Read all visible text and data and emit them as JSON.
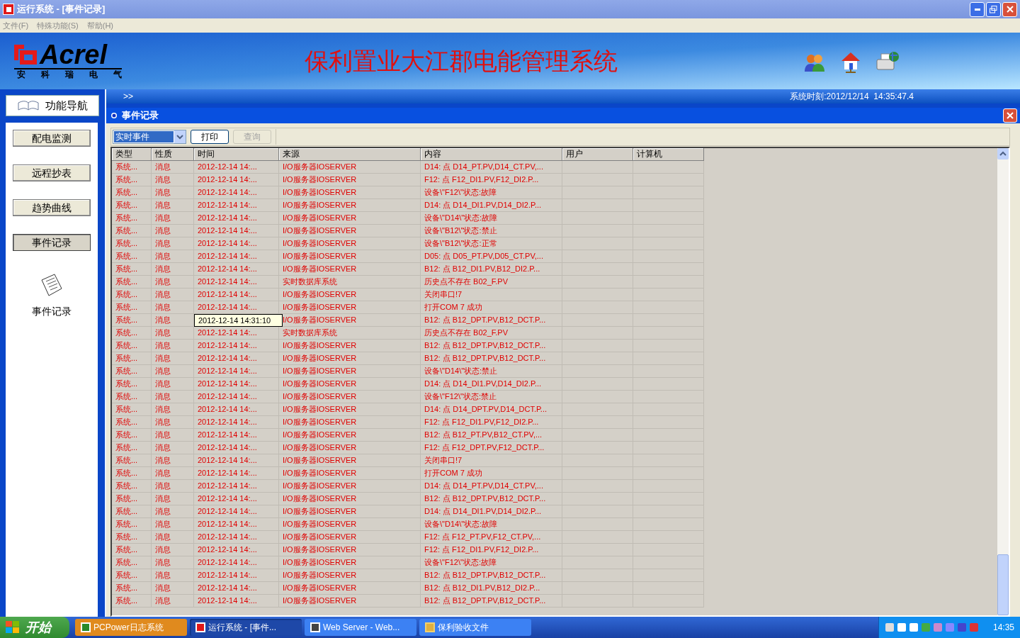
{
  "window": {
    "title": "运行系统 - [事件记录]"
  },
  "menu": [
    "文件(F)",
    "特殊功能(S)",
    "帮助(H)"
  ],
  "banner": {
    "logo": "Acrel",
    "logo_sub": [
      "安",
      "科",
      "瑞",
      "电",
      "气"
    ],
    "title": "保利置业大江郡电能管理系统"
  },
  "subbar": {
    "expander": ">>",
    "system_time": "系统时刻:2012/12/14  14:35:47.4"
  },
  "sidebar": {
    "header": "功能导航",
    "items": [
      {
        "label": "配电监测",
        "selected": false
      },
      {
        "label": "远程抄表",
        "selected": false
      },
      {
        "label": "趋势曲线",
        "selected": false
      },
      {
        "label": "事件记录",
        "selected": true
      }
    ],
    "current": "事件记录"
  },
  "panel": {
    "title": "事件记录",
    "filter": "实时事件",
    "buttons": [
      {
        "label": "打印",
        "disabled": false
      },
      {
        "label": "查询",
        "disabled": true
      }
    ]
  },
  "table": {
    "columns": [
      "类型",
      "性质",
      "时间",
      "来源",
      "内容",
      "用户",
      "计算机"
    ],
    "rows": [
      {
        "type": "系统...",
        "nature": "消息",
        "time": "2012-12-14 14:...",
        "source": "I/O服务器IOSERVER",
        "content": "D14: 点 D14_PT.PV,D14_CT.PV,..."
      },
      {
        "type": "系统...",
        "nature": "消息",
        "time": "2012-12-14 14:...",
        "source": "I/O服务器IOSERVER",
        "content": "F12: 点 F12_DI1.PV,F12_DI2.P..."
      },
      {
        "type": "系统...",
        "nature": "消息",
        "time": "2012-12-14 14:...",
        "source": "I/O服务器IOSERVER",
        "content": "设备\\\"F12\\\"状态:故障"
      },
      {
        "type": "系统...",
        "nature": "消息",
        "time": "2012-12-14 14:...",
        "source": "I/O服务器IOSERVER",
        "content": "D14: 点 D14_DI1.PV,D14_DI2.P..."
      },
      {
        "type": "系统...",
        "nature": "消息",
        "time": "2012-12-14 14:...",
        "source": "I/O服务器IOSERVER",
        "content": "设备\\\"D14\\\"状态:故障"
      },
      {
        "type": "系统...",
        "nature": "消息",
        "time": "2012-12-14 14:...",
        "source": "I/O服务器IOSERVER",
        "content": "设备\\\"B12\\\"状态:禁止"
      },
      {
        "type": "系统...",
        "nature": "消息",
        "time": "2012-12-14 14:...",
        "source": "I/O服务器IOSERVER",
        "content": "设备\\\"B12\\\"状态:正常"
      },
      {
        "type": "系统...",
        "nature": "消息",
        "time": "2012-12-14 14:...",
        "source": "I/O服务器IOSERVER",
        "content": "D05: 点 D05_PT.PV,D05_CT.PV,..."
      },
      {
        "type": "系统...",
        "nature": "消息",
        "time": "2012-12-14 14:...",
        "source": "I/O服务器IOSERVER",
        "content": "B12: 点 B12_DI1.PV,B12_DI2.P..."
      },
      {
        "type": "系统...",
        "nature": "消息",
        "time": "2012-12-14 14:...",
        "source": "实时数据库系统",
        "content": "历史点不存在 B02_F.PV"
      },
      {
        "type": "系统...",
        "nature": "消息",
        "time": "2012-12-14 14:...",
        "source": "I/O服务器IOSERVER",
        "content": "关闭串口!7"
      },
      {
        "type": "系统...",
        "nature": "消息",
        "time": "2012-12-14 14:...",
        "source": "I/O服务器IOSERVER",
        "content": "打开COM 7 成功"
      },
      {
        "type": "系统...",
        "nature": "消息",
        "time_tooltip": "2012-12-14 14:31:10",
        "source": "I/O服务器IOSERVER",
        "content": "B12: 点 B12_DPT.PV,B12_DCT.P..."
      },
      {
        "type": "系统...",
        "nature": "消息",
        "time": "2012-12-14 14:...",
        "source": "实时数据库系统",
        "content": "历史点不存在 B02_F.PV"
      },
      {
        "type": "系统...",
        "nature": "消息",
        "time": "2012-12-14 14:...",
        "source": "I/O服务器IOSERVER",
        "content": "B12: 点 B12_DPT.PV,B12_DCT.P..."
      },
      {
        "type": "系统...",
        "nature": "消息",
        "time": "2012-12-14 14:...",
        "source": "I/O服务器IOSERVER",
        "content": "B12: 点 B12_DPT.PV,B12_DCT.P..."
      },
      {
        "type": "系统...",
        "nature": "消息",
        "time": "2012-12-14 14:...",
        "source": "I/O服务器IOSERVER",
        "content": "设备\\\"D14\\\"状态:禁止"
      },
      {
        "type": "系统...",
        "nature": "消息",
        "time": "2012-12-14 14:...",
        "source": "I/O服务器IOSERVER",
        "content": "D14: 点 D14_DI1.PV,D14_DI2.P..."
      },
      {
        "type": "系统...",
        "nature": "消息",
        "time": "2012-12-14 14:...",
        "source": "I/O服务器IOSERVER",
        "content": "设备\\\"F12\\\"状态:禁止"
      },
      {
        "type": "系统...",
        "nature": "消息",
        "time": "2012-12-14 14:...",
        "source": "I/O服务器IOSERVER",
        "content": "D14: 点 D14_DPT.PV,D14_DCT.P..."
      },
      {
        "type": "系统...",
        "nature": "消息",
        "time": "2012-12-14 14:...",
        "source": "I/O服务器IOSERVER",
        "content": "F12: 点 F12_DI1.PV,F12_DI2.P..."
      },
      {
        "type": "系统...",
        "nature": "消息",
        "time": "2012-12-14 14:...",
        "source": "I/O服务器IOSERVER",
        "content": "B12: 点 B12_PT.PV,B12_CT.PV,..."
      },
      {
        "type": "系统...",
        "nature": "消息",
        "time": "2012-12-14 14:...",
        "source": "I/O服务器IOSERVER",
        "content": "F12: 点 F12_DPT.PV,F12_DCT.P..."
      },
      {
        "type": "系统...",
        "nature": "消息",
        "time": "2012-12-14 14:...",
        "source": "I/O服务器IOSERVER",
        "content": "关闭串口!7"
      },
      {
        "type": "系统...",
        "nature": "消息",
        "time": "2012-12-14 14:...",
        "source": "I/O服务器IOSERVER",
        "content": "打开COM 7 成功"
      },
      {
        "type": "系统...",
        "nature": "消息",
        "time": "2012-12-14 14:...",
        "source": "I/O服务器IOSERVER",
        "content": "D14: 点 D14_PT.PV,D14_CT.PV,..."
      },
      {
        "type": "系统...",
        "nature": "消息",
        "time": "2012-12-14 14:...",
        "source": "I/O服务器IOSERVER",
        "content": "B12: 点 B12_DPT.PV,B12_DCT.P..."
      },
      {
        "type": "系统...",
        "nature": "消息",
        "time": "2012-12-14 14:...",
        "source": "I/O服务器IOSERVER",
        "content": "D14: 点 D14_DI1.PV,D14_DI2.P..."
      },
      {
        "type": "系统...",
        "nature": "消息",
        "time": "2012-12-14 14:...",
        "source": "I/O服务器IOSERVER",
        "content": "设备\\\"D14\\\"状态:故障"
      },
      {
        "type": "系统...",
        "nature": "消息",
        "time": "2012-12-14 14:...",
        "source": "I/O服务器IOSERVER",
        "content": "F12: 点 F12_PT.PV,F12_CT.PV,..."
      },
      {
        "type": "系统...",
        "nature": "消息",
        "time": "2012-12-14 14:...",
        "source": "I/O服务器IOSERVER",
        "content": "F12: 点 F12_DI1.PV,F12_DI2.P..."
      },
      {
        "type": "系统...",
        "nature": "消息",
        "time": "2012-12-14 14:...",
        "source": "I/O服务器IOSERVER",
        "content": "设备\\\"F12\\\"状态:故障"
      },
      {
        "type": "系统...",
        "nature": "消息",
        "time": "2012-12-14 14:...",
        "source": "I/O服务器IOSERVER",
        "content": "B12: 点 B12_DPT.PV,B12_DCT.P..."
      },
      {
        "type": "系统...",
        "nature": "消息",
        "time": "2012-12-14 14:...",
        "source": "I/O服务器IOSERVER",
        "content": "B12: 点 B12_DI1.PV,B12_DI2.P..."
      },
      {
        "type": "系统...",
        "nature": "消息",
        "time": "2012-12-14 14:...",
        "source": "I/O服务器IOSERVER",
        "content": "B12: 点 B12_DPT.PV,B12_DCT.P..."
      }
    ]
  },
  "taskbar": {
    "start": "开始",
    "tasks": [
      {
        "label": "PCPower日志系统",
        "selected": false
      },
      {
        "label": "运行系统 - [事件...",
        "selected": true
      },
      {
        "label": "Web Server - Web...",
        "selected": false
      },
      {
        "label": "保利验收文件",
        "selected": false
      }
    ],
    "clock": "14:35"
  }
}
